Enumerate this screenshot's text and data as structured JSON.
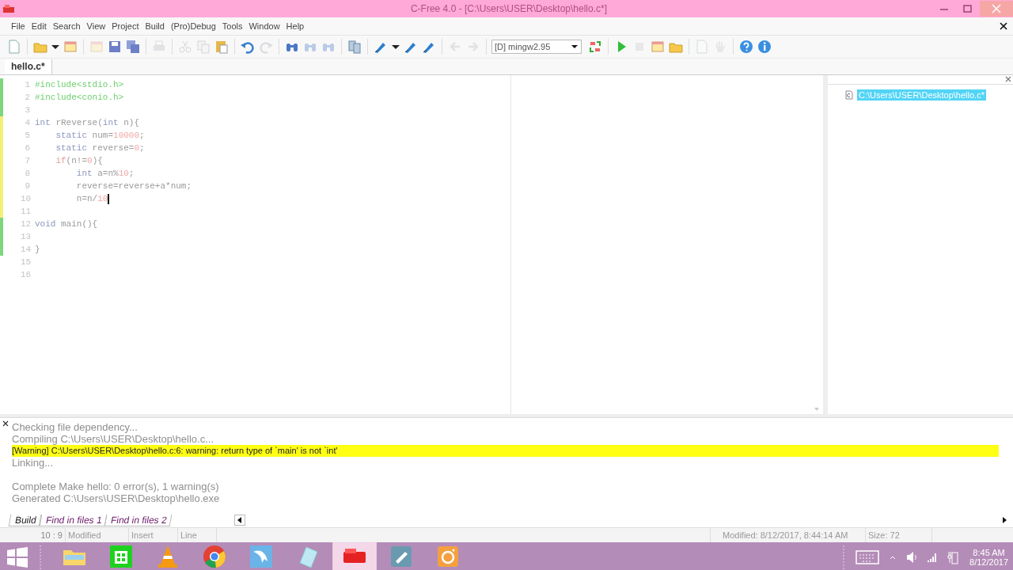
{
  "window": {
    "title": "C-Free 4.0 - [C:\\Users\\USER\\Desktop\\hello.c*]"
  },
  "menu": [
    "File",
    "Edit",
    "Search",
    "View",
    "Project",
    "Build",
    "(Pro)Debug",
    "Tools",
    "Window",
    "Help"
  ],
  "toolbar": [
    {
      "kind": "page",
      "disabled": false
    },
    {
      "kind": "sep"
    },
    {
      "kind": "folder",
      "disabled": false
    },
    {
      "kind": "caret",
      "disabled": false
    },
    {
      "kind": "window",
      "disabled": false
    },
    {
      "kind": "sep"
    },
    {
      "kind": "window",
      "disabled": true
    },
    {
      "kind": "save",
      "disabled": false
    },
    {
      "kind": "stack",
      "disabled": false
    },
    {
      "kind": "sep"
    },
    {
      "kind": "printer",
      "disabled": true
    },
    {
      "kind": "sep"
    },
    {
      "kind": "scissors",
      "disabled": true
    },
    {
      "kind": "copy",
      "disabled": true
    },
    {
      "kind": "clipboard",
      "disabled": false
    },
    {
      "kind": "sep"
    },
    {
      "kind": "undo",
      "disabled": false
    },
    {
      "kind": "redo",
      "disabled": true
    },
    {
      "kind": "sep"
    },
    {
      "kind": "binoculars",
      "disabled": false
    },
    {
      "kind": "binoculars",
      "disabled": true
    },
    {
      "kind": "binoculars",
      "disabled": true
    },
    {
      "kind": "sep"
    },
    {
      "kind": "files",
      "disabled": false
    },
    {
      "kind": "sep"
    },
    {
      "kind": "pen",
      "disabled": false
    },
    {
      "kind": "caret",
      "disabled": false
    },
    {
      "kind": "pen",
      "disabled": false
    },
    {
      "kind": "pen",
      "disabled": false
    },
    {
      "kind": "sep"
    },
    {
      "kind": "left",
      "disabled": true
    },
    {
      "kind": "right",
      "disabled": true
    },
    {
      "kind": "sep"
    }
  ],
  "compiler": {
    "value": "[D] mingw2.95"
  },
  "toolbar2": [
    {
      "kind": "swap",
      "disabled": false
    },
    {
      "kind": "sep"
    },
    {
      "kind": "play",
      "disabled": false
    },
    {
      "kind": "stop",
      "disabled": true
    },
    {
      "kind": "window",
      "disabled": false
    },
    {
      "kind": "folder",
      "disabled": false
    },
    {
      "kind": "sep"
    },
    {
      "kind": "page",
      "disabled": true
    },
    {
      "kind": "hand",
      "disabled": true
    },
    {
      "kind": "sep"
    },
    {
      "kind": "help",
      "disabled": false
    },
    {
      "kind": "info",
      "disabled": false
    }
  ],
  "tabs": [
    {
      "label": "hello.c*",
      "selected": true
    }
  ],
  "code": [
    {
      "number": "1",
      "color": "#7ed67e",
      "caret": false,
      "tokens": [
        {
          "t": "#include<stdio.h>",
          "kind": "pre"
        }
      ]
    },
    {
      "number": "2",
      "color": "#7ed67e",
      "caret": false,
      "tokens": [
        {
          "t": "#include<conio.h>",
          "kind": "pre"
        }
      ]
    },
    {
      "number": "3",
      "color": "#7ed67e",
      "caret": false
    },
    {
      "number": "4",
      "color": "#f3f07a",
      "caret": false,
      "tokens": [
        {
          "t": "int",
          "kind": "kw"
        },
        {
          "t": " rReverse(",
          "kind": "plain"
        },
        {
          "t": "int",
          "kind": "kw"
        },
        {
          "t": " n){",
          "kind": "plain"
        }
      ]
    },
    {
      "number": "5",
      "color": "#f3f07a",
      "caret": false,
      "tokens": [
        {
          "t": "    static",
          "kind": "kw"
        },
        {
          "t": " num=",
          "kind": "plain"
        },
        {
          "t": "10000",
          "kind": "num"
        },
        {
          "t": ";",
          "kind": "plain"
        }
      ]
    },
    {
      "number": "6",
      "color": "#f3f07a",
      "caret": false,
      "tokens": [
        {
          "t": "    static",
          "kind": "kw"
        },
        {
          "t": " reverse=",
          "kind": "plain"
        },
        {
          "t": "0",
          "kind": "num"
        },
        {
          "t": ";",
          "kind": "plain"
        }
      ]
    },
    {
      "number": "7",
      "color": "#f3f07a",
      "caret": false,
      "tokens": [
        {
          "t": "    if",
          "kind": "kw2"
        },
        {
          "t": "(n!=",
          "kind": "plain"
        },
        {
          "t": "0",
          "kind": "num"
        },
        {
          "t": "){",
          "kind": "plain"
        }
      ]
    },
    {
      "number": "8",
      "color": "#f3f07a",
      "caret": false,
      "tokens": [
        {
          "t": "        int",
          "kind": "kw"
        },
        {
          "t": " a=n%",
          "kind": "plain"
        },
        {
          "t": "10",
          "kind": "num"
        },
        {
          "t": ";",
          "kind": "plain"
        }
      ]
    },
    {
      "number": "9",
      "color": "#f3f07a",
      "caret": false,
      "tokens": [
        {
          "t": "        reverse=reverse+a*num;",
          "kind": "plain"
        }
      ]
    },
    {
      "number": "10",
      "color": "#f3f07a",
      "caret": true,
      "tokens": [
        {
          "t": "        n=n/",
          "kind": "plain"
        },
        {
          "t": "10",
          "kind": "num"
        }
      ]
    },
    {
      "number": "11",
      "color": "#f3f07a",
      "caret": false
    },
    {
      "number": "12",
      "color": "#7ed67e",
      "caret": false,
      "tokens": [
        {
          "t": "void",
          "kind": "kw"
        },
        {
          "t": " main(){",
          "kind": "plain"
        }
      ]
    },
    {
      "number": "13",
      "color": "#7ed67e",
      "caret": false
    },
    {
      "number": "14",
      "color": "#7ed67e",
      "caret": false,
      "tokens": [
        {
          "t": "}",
          "kind": "plain"
        }
      ]
    },
    {
      "number": "15",
      "caret": false
    },
    {
      "number": "16",
      "caret": false
    }
  ],
  "files": [
    {
      "label": "C:\\Users\\USER\\Desktop\\hello.c*",
      "selected": true
    }
  ],
  "output": [
    {
      "lines": [
        {
          "text": "Checking file dependency...",
          "kind": "info"
        },
        {
          "text": "Compiling C:\\Users\\USER\\Desktop\\hello.c...",
          "kind": "info"
        },
        {
          "text": "[Warning] C:\\Users\\USER\\Desktop\\hello.c:6: warning: return type of `main' is not `int'",
          "kind": "warning"
        },
        {
          "text": "Linking...",
          "kind": "info"
        }
      ]
    },
    {
      "lines": [
        {
          "text": "Complete Make hello: 0 error(s), 1 warning(s)",
          "kind": "info"
        },
        {
          "text": "Generated C:\\Users\\USER\\Desktop\\hello.exe",
          "kind": "info"
        }
      ]
    }
  ],
  "output_tabs": [
    {
      "label": "Build",
      "selected": true
    },
    {
      "label": "Find in files 1",
      "selected": false
    },
    {
      "label": "Find in files 2",
      "selected": false
    }
  ],
  "status_bar": {
    "position": "10 : 9",
    "state": "Modified",
    "mode": "Insert",
    "unit": "Line",
    "modified": "Modified: 8/12/2017, 8:44:14 AM",
    "size": "Size: 72"
  },
  "taskbar": {
    "apps": [
      {
        "kind": "folder",
        "active": false
      },
      {
        "kind": "store",
        "active": false
      },
      {
        "kind": "cone",
        "active": false
      },
      {
        "kind": "chrome",
        "active": false
      },
      {
        "kind": "dolphin",
        "active": false
      },
      {
        "kind": "notebook",
        "active": false
      },
      {
        "kind": "cfree",
        "active": true
      },
      {
        "kind": "editor",
        "active": false
      },
      {
        "kind": "camera",
        "active": false
      }
    ],
    "time": "8:45 AM",
    "date": "8/12/2017"
  }
}
